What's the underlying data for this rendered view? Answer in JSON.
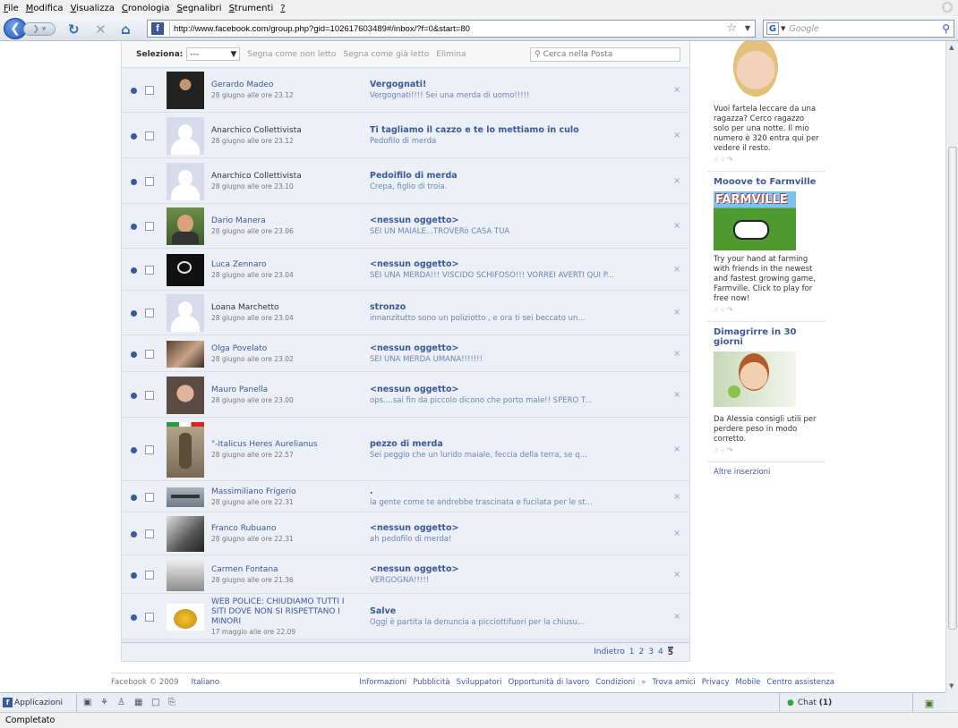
{
  "browser": {
    "menu": [
      "File",
      "Modifica",
      "Visualizza",
      "Cronologia",
      "Segnalibri",
      "Strumenti",
      "?"
    ],
    "url": "http://www.facebook.com/group.php?gid=102617603489#/inbox/?f=0&start=80",
    "search_placeholder": "Google",
    "status": "Completato"
  },
  "toolbar": {
    "select_label": "Seleziona:",
    "select_value": "---",
    "mark_unread": "Segna come non letto",
    "mark_read": "Segna come già letto",
    "delete": "Elimina",
    "search_placeholder": "Cerca nella Posta"
  },
  "messages": [
    {
      "name": "Gerardo Madeo",
      "date": "28 giugno alle ore 23.12",
      "subject": "Vergognati!",
      "snippet": "Vergognati!!!! Sei una merda di uomo!!!!!",
      "avatar": "photo-dark",
      "name_link": true
    },
    {
      "name": "Anarchico Collettivista",
      "date": "28 giugno alle ore 23.12",
      "subject": "Ti tagliamo il cazzo e te lo mettiamo in culo",
      "snippet": "Pedofilo di merda",
      "avatar": "default",
      "name_link": false
    },
    {
      "name": "Anarchico Collettivista",
      "date": "28 giugno alle ore 23.10",
      "subject": "Pedoifilo di merda",
      "snippet": "Crepa, figlio di troia.",
      "avatar": "default",
      "name_link": false
    },
    {
      "name": "Dario Manera",
      "date": "28 giugno alle ore 23.06",
      "subject": "<nessun oggetto>",
      "snippet": "SEI UN MAIALE...TROVERò CASA TUA",
      "avatar": "photo-green",
      "name_link": true
    },
    {
      "name": "Luca Zennaro",
      "date": "28 giugno alle ore 23.04",
      "subject": "<nessun oggetto>",
      "snippet": "SEI UNA MERDA!!! VISCIDO SCHIFOSO!!! VORREI AVERTI QUI P...",
      "avatar": "photo-black",
      "name_link": true
    },
    {
      "name": "Loana Marchetto",
      "date": "28 giugno alle ore 23.04",
      "subject": "stronzo",
      "snippet": "innanzitutto sono un poliziotto , e ora ti sei beccato un...",
      "avatar": "default",
      "name_link": false
    },
    {
      "name": "Olga Povelato",
      "date": "28 giugno alle ore 23.02",
      "subject": "<nessun oggetto>",
      "snippet": "SEI UNA MERDA UMANA!!!!!!!",
      "avatar": "photo-warm",
      "name_link": true
    },
    {
      "name": "Mauro Panella",
      "date": "28 giugno alle ore 23.00",
      "subject": "<nessun oggetto>",
      "snippet": "ops....sai fin da piccolo dicono che porto male!! SPERO T...",
      "avatar": "photo-face",
      "name_link": true
    },
    {
      "name": "\"-Italicus Heres Aurelianus",
      "date": "28 giugno alle ore 22.57",
      "subject": "pezzo di merda",
      "snippet": "Sei peggio che un lurido maiale, feccia della terra, se q...",
      "avatar": "photo-tall",
      "name_link": true
    },
    {
      "name": "Massimiliano Frigerio",
      "date": "28 giugno alle ore 22.31",
      "subject": ".",
      "snippet": "la gente come te andrebbe trascinata e fucilata per le st...",
      "avatar": "photo-jet",
      "name_link": true
    },
    {
      "name": "Franco Rubuano",
      "date": "28 giugno alle ore 22.31",
      "subject": "<nessun oggetto>",
      "snippet": "ah pedofilo di merda!",
      "avatar": "photo-bw",
      "name_link": true
    },
    {
      "name": "Carmen Fontana",
      "date": "28 giugno alle ore 21.36",
      "subject": "<nessun oggetto>",
      "snippet": "VERGOGNA!!!!!",
      "avatar": "photo-group",
      "name_link": true
    },
    {
      "name": "WEB POLICE: CHIUDIAMO TUTTI I SITI DOVE NON SI RISPETTANO I MINORI",
      "date": "17 maggio alle ore 22.09",
      "subject": "Salve",
      "snippet": "Oggi è partita la denuncia a picciottifuori per la chiusu...",
      "avatar": "photo-logo",
      "name_link": true
    }
  ],
  "pager": {
    "prev": "Indietro",
    "pages": [
      "1",
      "2",
      "3",
      "4",
      "5"
    ],
    "current": "5"
  },
  "ads": [
    {
      "title": "",
      "text": "Vuoi fartela leccare da una ragazza? Cerco ragazzo solo per una notte. Il mio numero è 320 entra qui per vedere il resto.",
      "pic": "face-blonde"
    },
    {
      "title": "Mooove to Farmville",
      "text": "Try your hand at farming with friends in the newest and fastest growing game, Farmville. Click to play for free now!",
      "pic": "farmville",
      "pic_label": "FARMVILLE"
    },
    {
      "title": "Dimagrirre in 30 giorni",
      "text": "Da Alessia consigli utili per perdere peso in modo corretto.",
      "pic": "face-apple"
    }
  ],
  "ads_more": "Altre inserzioni",
  "footer": {
    "copyright": "Facebook © 2009",
    "language": "Italiano",
    "links": [
      "Informazioni",
      "Pubblicità",
      "Sviluppatori",
      "Opportunità di lavoro",
      "Condizioni",
      "»",
      "Trova amici",
      "Privacy",
      "Mobile",
      "Centro assistenza"
    ]
  },
  "chatbar": {
    "apps": "Applicazioni",
    "chat_label": "Chat",
    "chat_count": "(1)"
  },
  "colors": {
    "fb_blue": "#3b5998",
    "link": "#3b5998",
    "snippet": "#6d84b4"
  }
}
